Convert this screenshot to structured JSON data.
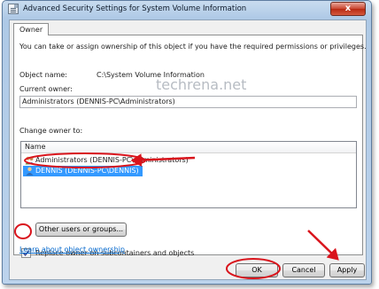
{
  "window": {
    "title": "Advanced Security Settings for System Volume Information",
    "close_glyph": "x"
  },
  "tabs": [
    {
      "label": "Owner"
    }
  ],
  "owner_panel": {
    "intro": "You can take or assign ownership of this object if you have the required permissions or privileges.",
    "object_name_label": "Object name:",
    "object_name_value": "C:\\System Volume Information",
    "current_owner_label": "Current owner:",
    "current_owner_value": "Administrators (DENNIS-PC\\Administrators)",
    "change_owner_label": "Change owner to:",
    "list_header": "Name",
    "owners": [
      {
        "name": "Administrators (DENNIS-PC\\Administrators)",
        "selected": false
      },
      {
        "name": "DENNIS (DENNIS-PC\\DENNIS)",
        "selected": true
      }
    ],
    "other_users_button": "Other users or groups...",
    "replace_checkbox_label": "Replace owner on subcontainers and objects",
    "replace_checked": true,
    "learn_link": "Learn about object ownership"
  },
  "watermark": "techrena.net",
  "buttons": {
    "ok": "OK",
    "cancel": "Cancel",
    "apply": "Apply"
  },
  "colors": {
    "selection": "#3399ff",
    "annotation_red": "#d9141c",
    "link": "#0066cc"
  }
}
